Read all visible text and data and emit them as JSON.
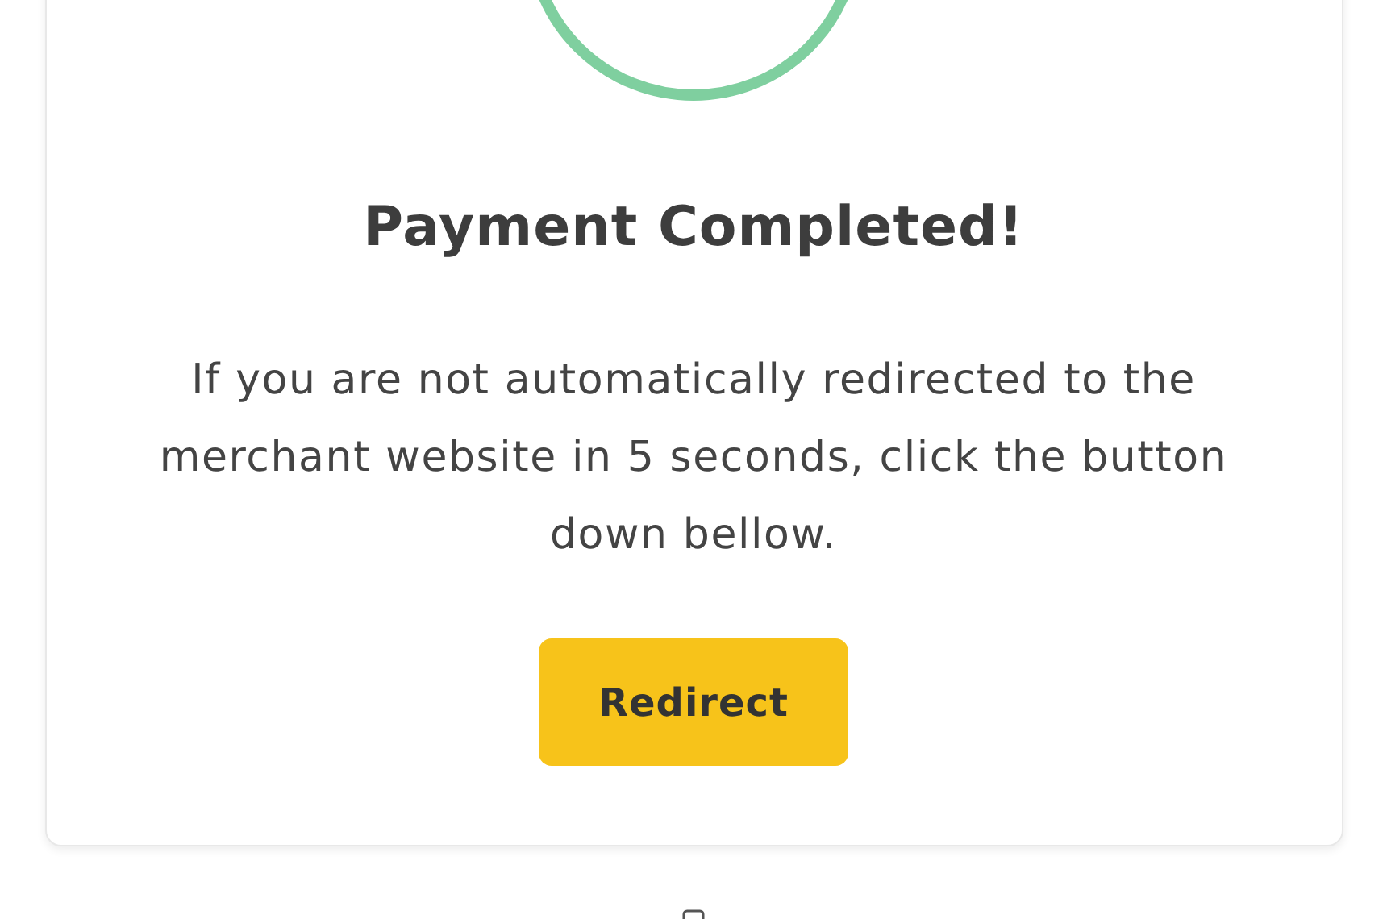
{
  "status": {
    "kind": "success"
  },
  "title": "Payment Completed!",
  "message": "If you are not automatically redirected to the merchant website in 5 seconds, click the button down bellow.",
  "button": {
    "label": "Redirect"
  }
}
